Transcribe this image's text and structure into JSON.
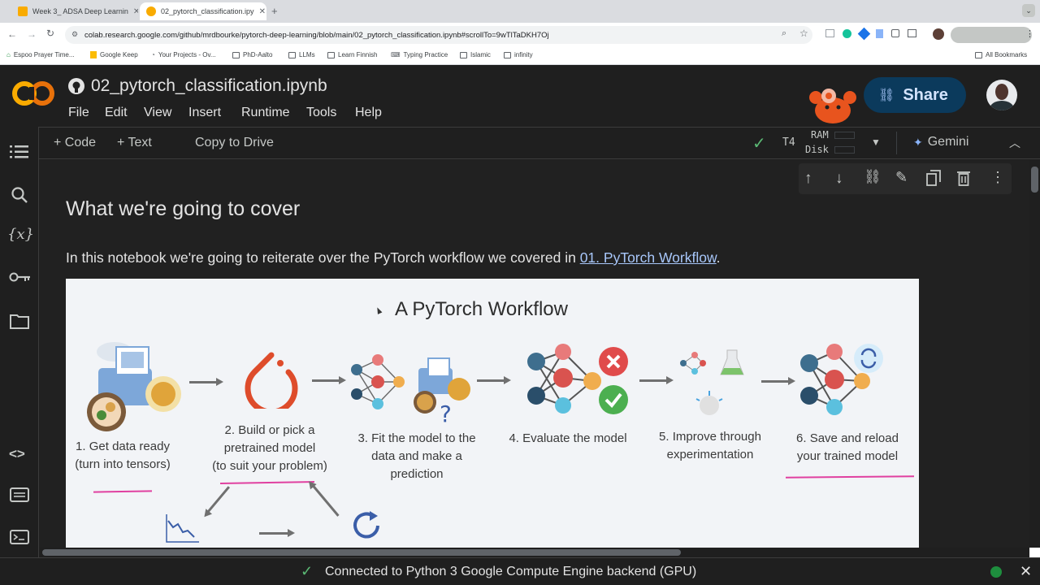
{
  "browser": {
    "tabs": [
      {
        "label": "Week 3_ ADSA Deep Learnin",
        "active": false
      },
      {
        "label": "02_pytorch_classification.ipy",
        "active": true
      }
    ],
    "url": "colab.research.google.com/github/mrdbourke/pytorch-deep-learning/blob/main/02_pytorch_classification.ipynb#scrollTo=9wTlTaDKH7Oj",
    "bookmarks": [
      "Espoo Prayer Time...",
      "Google Keep",
      "Your Projects - Ov...",
      "PhD-Aalto",
      "LLMs",
      "Learn Finnish",
      "Typing Practice",
      "Islamic",
      "infinity"
    ],
    "all_bookmarks": "All Bookmarks"
  },
  "colab": {
    "logo": "CO",
    "notebook_title": "02_pytorch_classification.ipynb",
    "menu": [
      "File",
      "Edit",
      "View",
      "Insert",
      "Runtime",
      "Tools",
      "Help"
    ],
    "share_label": "Share",
    "toolbar": {
      "code_label": "+ Code",
      "text_label": "+ Text",
      "copy_to_drive": "Copy to Drive",
      "runtime_type": "T4",
      "ram_label": "RAM",
      "disk_label": "Disk",
      "gemini_label": "Gemini"
    }
  },
  "content": {
    "heading": "What we're going to cover",
    "paragraph_prefix": "In this notebook we're going to reiterate over the PyTorch workflow we covered in ",
    "link_text": "01. PyTorch Workflow",
    "paragraph_suffix": ".",
    "workflow": {
      "title": "A PyTorch Workflow",
      "steps": [
        {
          "line1": "1. Get data ready",
          "line2": "(turn into tensors)",
          "line3": ""
        },
        {
          "line1": "2. Build or pick a",
          "line2": "pretrained model",
          "line3": "(to suit your problem)"
        },
        {
          "line1": "3. Fit the model to the",
          "line2": "data and make a",
          "line3": "prediction"
        },
        {
          "line1": "4. Evaluate the model",
          "line2": "",
          "line3": ""
        },
        {
          "line1": "5. Improve through",
          "line2": "experimentation",
          "line3": ""
        },
        {
          "line1": "6. Save and reload",
          "line2": "your trained model",
          "line3": ""
        }
      ]
    }
  },
  "status": {
    "message": "Connected to Python 3 Google Compute Engine backend (GPU)"
  },
  "colors": {
    "accent_orange": "#f9ab00",
    "share_bg": "#0b3a5c",
    "link": "#a8c7fa",
    "connected_green": "#1e8e3e"
  }
}
